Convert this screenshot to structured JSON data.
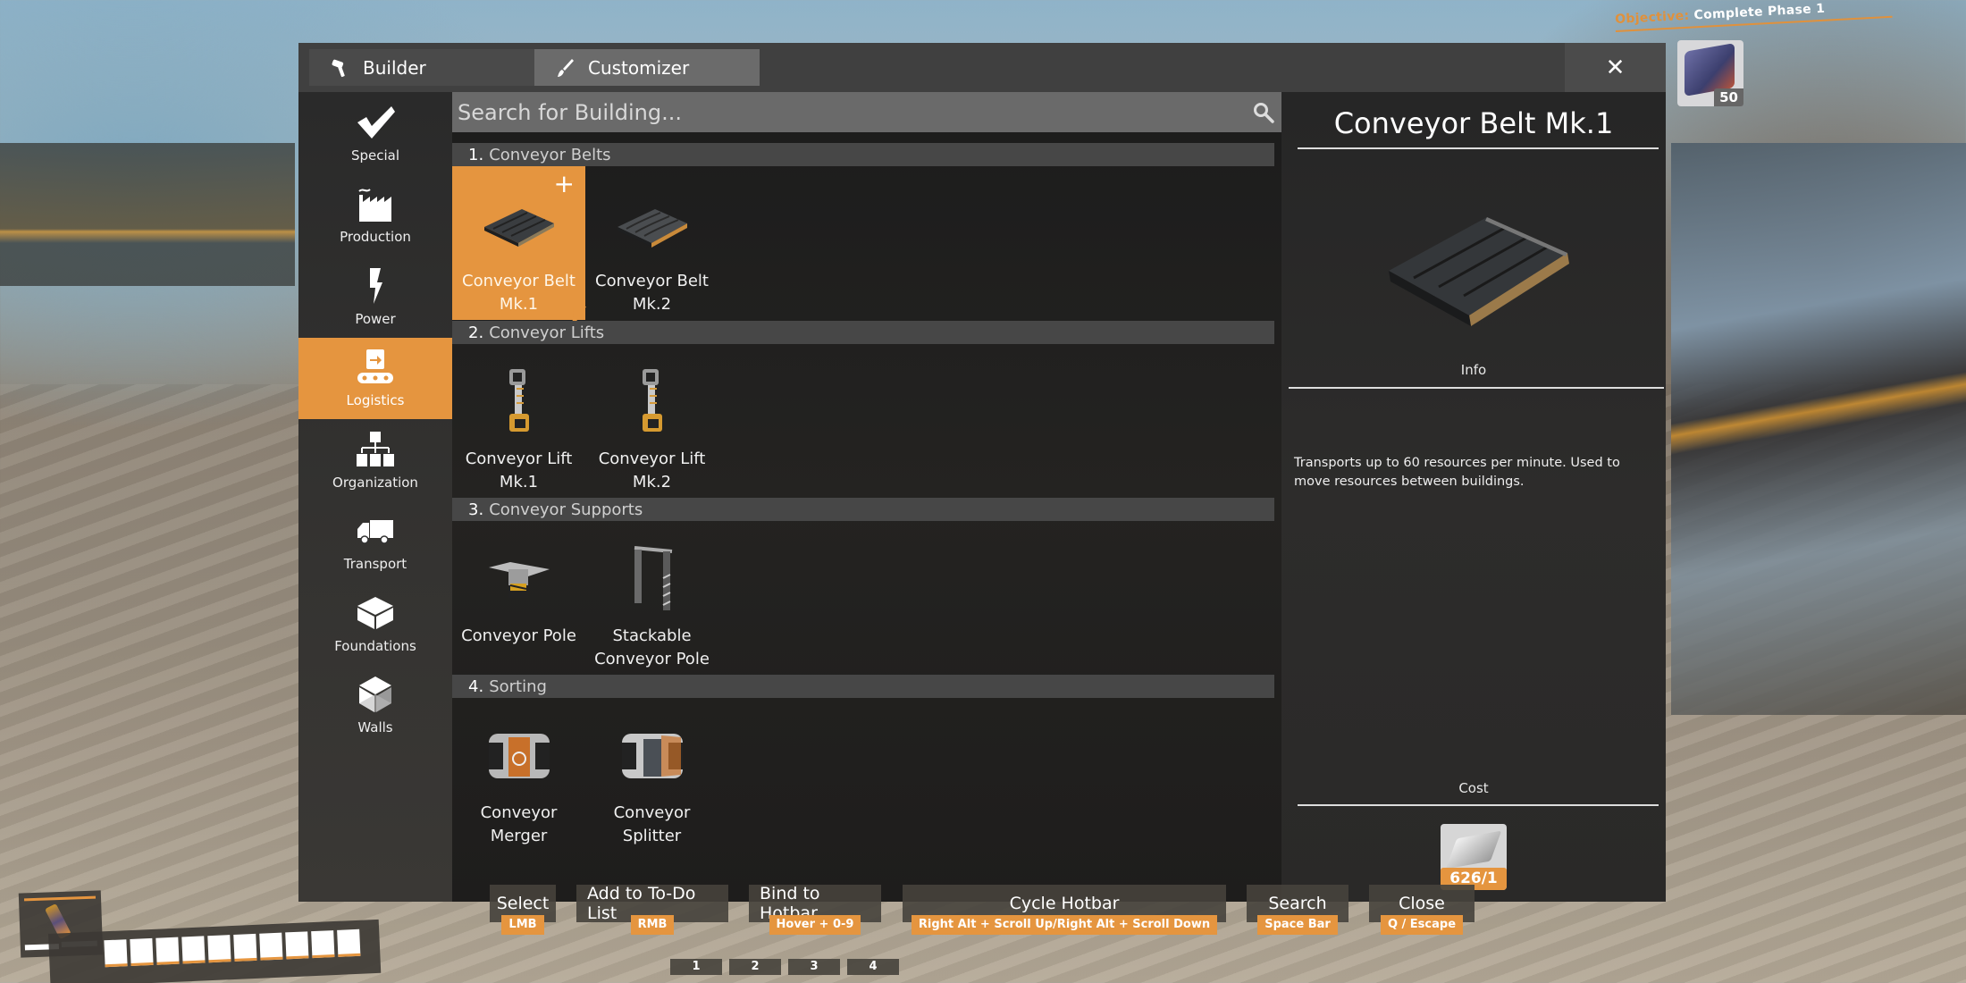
{
  "objective": {
    "label": "Objective:",
    "text": "Complete Phase 1",
    "item_count": "50"
  },
  "tabs": [
    {
      "label": "Builder",
      "icon": "hammer-icon"
    },
    {
      "label": "Customizer",
      "icon": "paintbrush-icon"
    }
  ],
  "close_label": "✕",
  "categories": [
    {
      "label": "Special",
      "icon": "checkmark-icon",
      "active": false
    },
    {
      "label": "Production",
      "icon": "factory-icon",
      "active": false
    },
    {
      "label": "Power",
      "icon": "lightning-icon",
      "active": false
    },
    {
      "label": "Logistics",
      "icon": "conveyor-icon",
      "active": true
    },
    {
      "label": "Organization",
      "icon": "hierarchy-icon",
      "active": false
    },
    {
      "label": "Transport",
      "icon": "truck-icon",
      "active": false
    },
    {
      "label": "Foundations",
      "icon": "foundation-block-icon",
      "active": false
    },
    {
      "label": "Walls",
      "icon": "wall-cube-icon",
      "active": false
    }
  ],
  "search": {
    "placeholder": "Search for Building...",
    "value": ""
  },
  "sections": [
    {
      "num": "1.",
      "title": "Conveyor Belts",
      "items": [
        {
          "line1": "Conveyor Belt",
          "line2": "Mk.1",
          "selected": true
        },
        {
          "line1": "Conveyor Belt",
          "line2": "Mk.2",
          "selected": false
        }
      ]
    },
    {
      "num": "2.",
      "title": "Conveyor Lifts",
      "items": [
        {
          "line1": "Conveyor Lift",
          "line2": "Mk.1"
        },
        {
          "line1": "Conveyor Lift",
          "line2": "Mk.2"
        }
      ]
    },
    {
      "num": "3.",
      "title": "Conveyor Supports",
      "items": [
        {
          "line1": "Conveyor Pole",
          "line2": ""
        },
        {
          "line1": "Stackable",
          "line2": "Conveyor Pole"
        }
      ]
    },
    {
      "num": "4.",
      "title": "Sorting",
      "items": [
        {
          "line1": "Conveyor",
          "line2": "Merger"
        },
        {
          "line1": "Conveyor",
          "line2": "Splitter"
        }
      ]
    }
  ],
  "add_badge": "+",
  "info": {
    "title": "Conveyor Belt Mk.1",
    "info_label": "Info",
    "description": "Transports up to 60 resources per minute. Used to move resources between buildings.",
    "cost_label": "Cost",
    "cost_amount": "626/1"
  },
  "hints": [
    {
      "label": "Select",
      "key": "LMB"
    },
    {
      "label": "Add to To-Do List",
      "key": "RMB"
    },
    {
      "label": "Bind to Hotbar",
      "key": "Hover + 0-9"
    },
    {
      "label": "Cycle Hotbar",
      "key": "Right Alt + Scroll Up/Right Alt + Scroll Down"
    },
    {
      "label": "Search",
      "key": "Space Bar"
    },
    {
      "label": "Close",
      "key": "Q / Escape"
    }
  ],
  "hotbar_numbers": [
    "1",
    "2",
    "3",
    "4"
  ]
}
